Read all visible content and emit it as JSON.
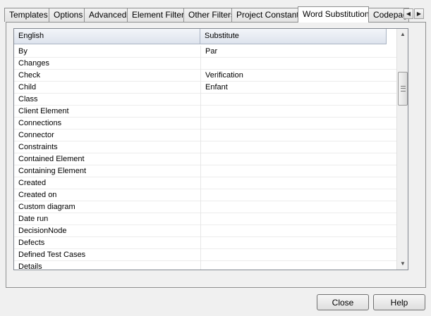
{
  "tabs": [
    {
      "label": "Templates",
      "active": false
    },
    {
      "label": "Options",
      "active": false
    },
    {
      "label": "Advanced",
      "active": false
    },
    {
      "label": "Element Filters",
      "active": false
    },
    {
      "label": "Other Filters",
      "active": false
    },
    {
      "label": "Project Constants",
      "active": false
    },
    {
      "label": "Word Substitution",
      "active": true
    },
    {
      "label": "Codepage",
      "active": false
    }
  ],
  "tab_scroll": {
    "left_glyph": "◀",
    "right_glyph": "▶"
  },
  "grid": {
    "columns": [
      "English",
      "Substitute"
    ],
    "rows": [
      {
        "english": "By",
        "substitute": "Par"
      },
      {
        "english": "Changes",
        "substitute": ""
      },
      {
        "english": "Check",
        "substitute": "Verification"
      },
      {
        "english": "Child",
        "substitute": "Enfant"
      },
      {
        "english": "Class",
        "substitute": ""
      },
      {
        "english": "Client Element",
        "substitute": ""
      },
      {
        "english": "Connections",
        "substitute": ""
      },
      {
        "english": "Connector",
        "substitute": ""
      },
      {
        "english": "Constraints",
        "substitute": ""
      },
      {
        "english": "Contained Element",
        "substitute": ""
      },
      {
        "english": "Containing Element",
        "substitute": ""
      },
      {
        "english": "Created",
        "substitute": ""
      },
      {
        "english": "Created on",
        "substitute": ""
      },
      {
        "english": "Custom diagram",
        "substitute": ""
      },
      {
        "english": "Date run",
        "substitute": ""
      },
      {
        "english": "DecisionNode",
        "substitute": ""
      },
      {
        "english": "Defects",
        "substitute": ""
      },
      {
        "english": "Defined Test Cases",
        "substitute": ""
      },
      {
        "english": "Details",
        "substitute": ""
      }
    ]
  },
  "scrollbar": {
    "up_glyph": "▲",
    "down_glyph": "▼"
  },
  "buttons": {
    "close": "Close",
    "help": "Help"
  }
}
